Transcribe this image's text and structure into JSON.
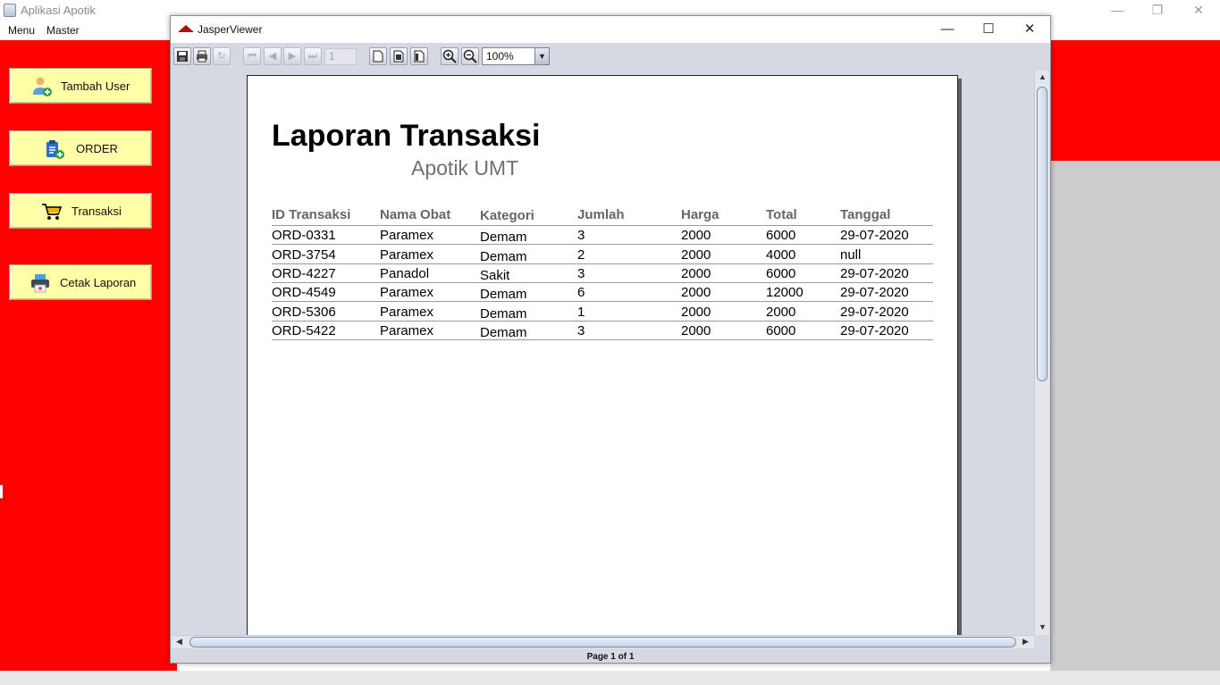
{
  "app": {
    "title": "Aplikasi Apotik",
    "controls": {
      "minimize": "—",
      "restore": "❐",
      "close": "✕"
    },
    "menu": [
      "Menu",
      "Master"
    ]
  },
  "sidebar": {
    "buttons": [
      {
        "label": "Tambah User",
        "icon": "add-user-icon"
      },
      {
        "label": "ORDER",
        "icon": "order-icon"
      },
      {
        "label": "Transaksi",
        "icon": "cart-icon"
      },
      {
        "label": "Cetak Laporan",
        "icon": "printer-icon"
      }
    ]
  },
  "viewer": {
    "title": "JasperViewer",
    "controls": {
      "minimize": "—",
      "maximize": "☐",
      "close": "✕"
    },
    "toolbar": {
      "page_number": "1",
      "zoom": "100%",
      "icons": [
        "save-icon",
        "print-icon",
        "reload-icon",
        "first-page-icon",
        "previous-page-icon",
        "next-page-icon",
        "last-page-icon",
        "actual-size-icon",
        "fit-page-icon",
        "fit-width-icon",
        "zoom-in-icon",
        "zoom-out-icon"
      ]
    },
    "status": "Page 1 of 1"
  },
  "report": {
    "title": "Laporan Transaksi",
    "subtitle": "Apotik UMT",
    "columns": [
      "ID Transaksi",
      "Nama Obat",
      "Kategori",
      "Jumlah",
      "Harga",
      "Total",
      "Tanggal"
    ],
    "rows": [
      [
        "ORD-0331",
        "Paramex",
        "Demam",
        "3",
        "2000",
        "6000",
        "29-07-2020"
      ],
      [
        "ORD-3754",
        "Paramex",
        "Demam",
        "2",
        "2000",
        "4000",
        "null"
      ],
      [
        "ORD-4227",
        "Panadol",
        "Sakit",
        "3",
        "2000",
        "6000",
        "29-07-2020"
      ],
      [
        "ORD-4549",
        "Paramex",
        "Demam",
        "6",
        "2000",
        "12000",
        "29-07-2020"
      ],
      [
        "ORD-5306",
        "Paramex",
        "Demam",
        "1",
        "2000",
        "2000",
        "29-07-2020"
      ],
      [
        "ORD-5422",
        "Paramex",
        "Demam",
        "3",
        "2000",
        "6000",
        "29-07-2020"
      ]
    ]
  },
  "colors": {
    "sidebar_bg": "#ff0000",
    "button_bg": "#ffffa8",
    "viewer_bg": "#d6d9e2"
  }
}
